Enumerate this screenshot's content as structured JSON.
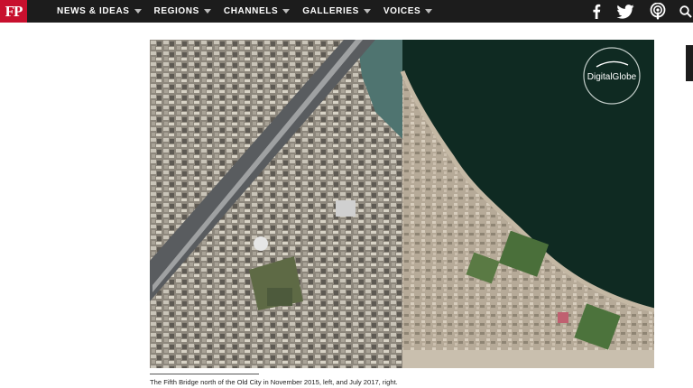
{
  "brand": {
    "logo_text": "FP",
    "color": "#c8102e"
  },
  "nav": {
    "items": [
      {
        "label": "NEWS & IDEAS"
      },
      {
        "label": "REGIONS"
      },
      {
        "label": "CHANNELS"
      },
      {
        "label": "GALLERIES"
      },
      {
        "label": "VOICES"
      }
    ]
  },
  "social": {
    "icons": [
      "facebook-icon",
      "twitter-icon",
      "podcast-icon",
      "search-icon"
    ]
  },
  "photo": {
    "watermark": "DigitalGlobe",
    "caption": "The Fifth Bridge north of the Old City in November 2015, left, and July 2017, right."
  },
  "colors": {
    "topbar": "#1c1c1c",
    "water": "#0f2a22",
    "urban": "#8a8378"
  }
}
